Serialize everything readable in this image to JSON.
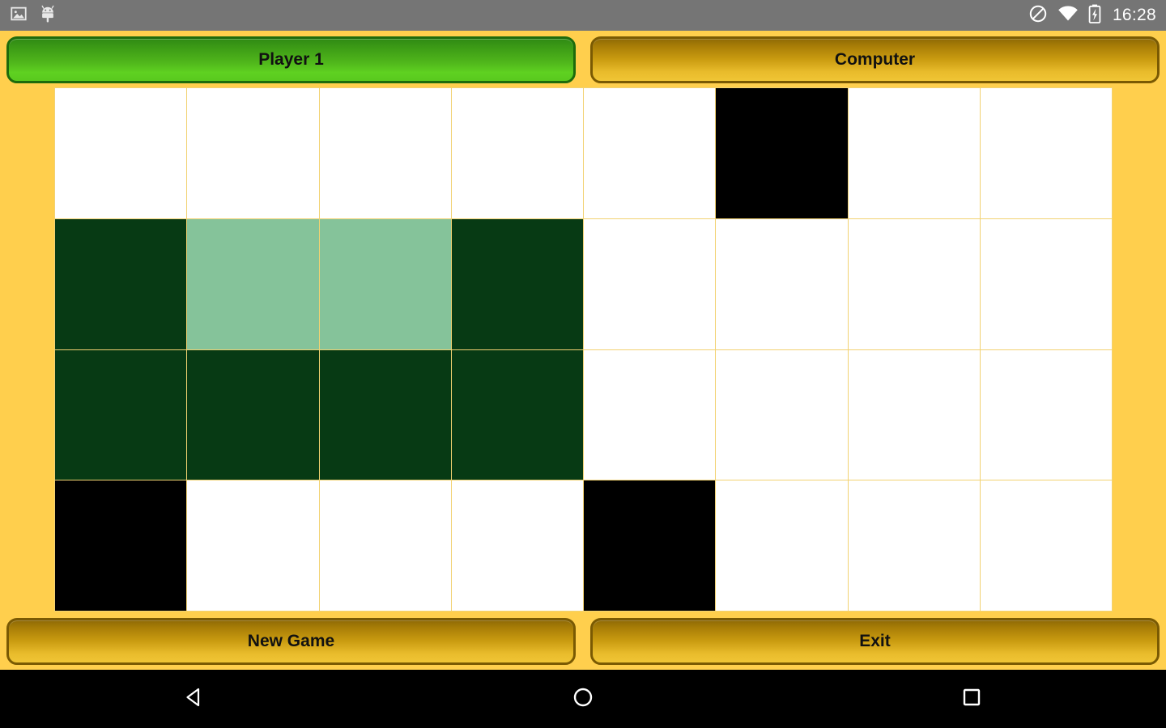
{
  "status_bar": {
    "icons_left": [
      "image-icon",
      "android-robot-icon"
    ],
    "icons_right": [
      "do-not-disturb-icon",
      "wifi-icon",
      "battery-charging-icon"
    ],
    "time": "16:28",
    "background_color": "#757575",
    "text_color": "#ffffff"
  },
  "top_bar": {
    "player_button_label": "Player 1",
    "computer_button_label": "Computer",
    "player_active_color": "#4fb51b",
    "computer_color": "#c99b10"
  },
  "board": {
    "columns": 8,
    "rows": 4,
    "legend": {
      "empty": "#ffffff",
      "black": "#000000",
      "dark": "#073a14",
      "light": "#85c39a",
      "gridline": "#f2d272"
    },
    "cells": [
      [
        "empty",
        "empty",
        "empty",
        "empty",
        "empty",
        "black",
        "empty",
        "empty"
      ],
      [
        "dark",
        "light",
        "light",
        "dark",
        "empty",
        "empty",
        "empty",
        "empty"
      ],
      [
        "dark",
        "dark",
        "dark",
        "dark",
        "empty",
        "empty",
        "empty",
        "empty"
      ],
      [
        "black",
        "empty",
        "empty",
        "empty",
        "black",
        "empty",
        "empty",
        "empty"
      ]
    ]
  },
  "bottom_bar": {
    "new_game_label": "New Game",
    "exit_label": "Exit"
  },
  "nav_bar": {
    "back_icon": "back-triangle-icon",
    "home_icon": "home-circle-icon",
    "recents_icon": "recents-square-icon",
    "background_color": "#000000"
  },
  "app": {
    "background_color": "#ffcf4d"
  }
}
